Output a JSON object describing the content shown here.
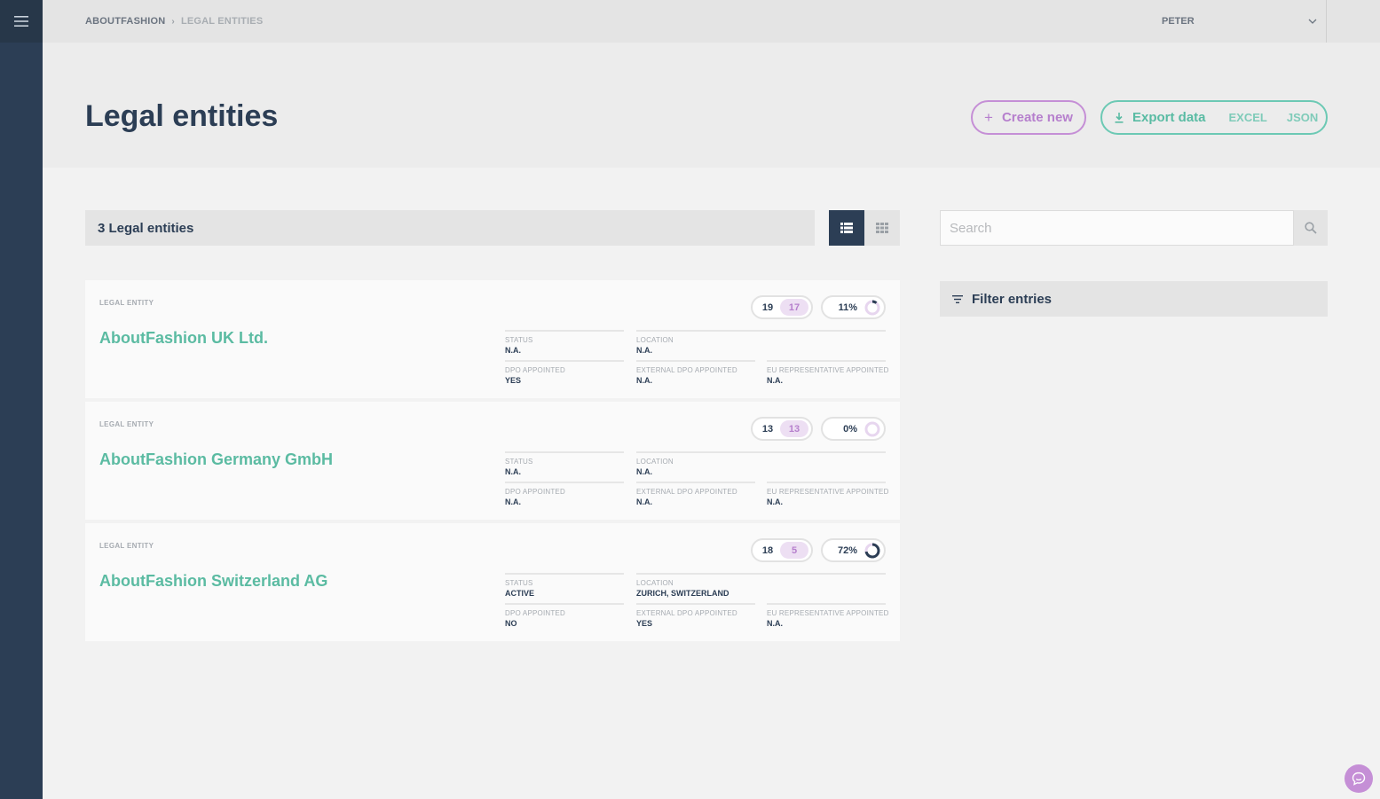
{
  "breadcrumb": {
    "root": "ABOUTFASHION",
    "separator": "›",
    "current": "LEGAL ENTITIES"
  },
  "user": {
    "name": "PETER"
  },
  "page": {
    "title": "Legal entities"
  },
  "actions": {
    "create_label": "Create new",
    "export_label": "Export data",
    "export_options": [
      "EXCEL",
      "JSON"
    ]
  },
  "list": {
    "count_label": "3 Legal entities"
  },
  "search": {
    "placeholder": "Search"
  },
  "filter": {
    "label": "Filter entries"
  },
  "field_labels": {
    "status": "STATUS",
    "location": "LOCATION",
    "dpo": "DPO APPOINTED",
    "ext_dpo": "EXTERNAL DPO APPOINTED",
    "eu_rep": "EU REPRESENTATIVE APPOINTED"
  },
  "entities": [
    {
      "type": "LEGAL ENTITY",
      "name": "AboutFashion UK Ltd.",
      "count_total": "19",
      "count_open": "17",
      "progress_label": "11%",
      "progress": 0.11,
      "status": "N.A.",
      "location": "N.A.",
      "dpo": "YES",
      "ext_dpo": "N.A.",
      "eu_rep": "N.A."
    },
    {
      "type": "LEGAL ENTITY",
      "name": "AboutFashion Germany GmbH",
      "count_total": "13",
      "count_open": "13",
      "progress_label": "0%",
      "progress": 0.0,
      "status": "N.A.",
      "location": "N.A.",
      "dpo": "N.A.",
      "ext_dpo": "N.A.",
      "eu_rep": "N.A."
    },
    {
      "type": "LEGAL ENTITY",
      "name": "AboutFashion Switzerland AG",
      "count_total": "18",
      "count_open": "5",
      "progress_label": "72%",
      "progress": 0.72,
      "status": "ACTIVE",
      "location": "ZURICH, SWITZERLAND",
      "dpo": "NO",
      "ext_dpo": "YES",
      "eu_rep": "N.A."
    }
  ],
  "icons": {
    "menu": "hamburger-icon",
    "user_dropdown": "chevron-down-icon",
    "create": "plus-icon",
    "export": "download-icon",
    "view_list": "list-view-icon",
    "view_grid": "grid-view-icon",
    "search": "search-icon",
    "filter": "filter-icon",
    "chat": "chat-icon"
  },
  "colors": {
    "sidebar": "#2c3e55",
    "accent_green": "#5bbba2",
    "accent_purple": "#c58fd6",
    "donut_track": "#e7d6ef",
    "donut_fill": "#2c3e55"
  }
}
